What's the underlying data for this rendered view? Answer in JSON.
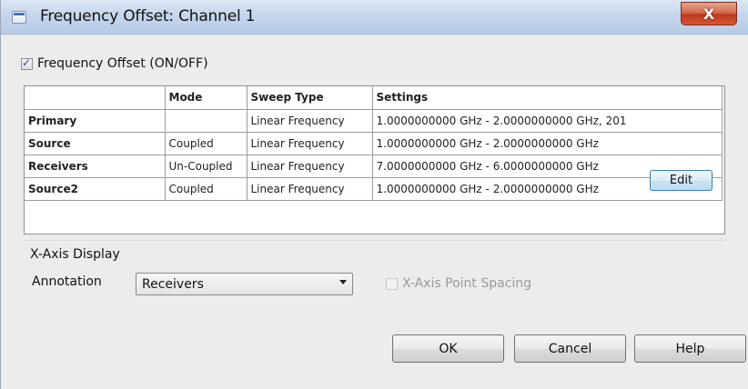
{
  "window": {
    "title": "Frequency Offset: Channel 1",
    "close_label": "X"
  },
  "frequency_offset": {
    "label": "Frequency Offset (ON/OFF)",
    "checked": true
  },
  "table": {
    "headers": [
      "",
      "Mode",
      "Sweep Type",
      "Settings"
    ],
    "rows": [
      {
        "name": "Primary",
        "mode": "",
        "sweep_type": "Linear Frequency",
        "settings": "1.0000000000 GHz - 2.0000000000 GHz, 201"
      },
      {
        "name": "Source",
        "mode": "Coupled",
        "sweep_type": "Linear Frequency",
        "settings": "1.0000000000 GHz - 2.0000000000 GHz"
      },
      {
        "name": "Receivers",
        "mode": "Un-Coupled",
        "sweep_type": "Linear Frequency",
        "settings": "7.0000000000 GHz - 6.0000000000 GHz"
      },
      {
        "name": "Source2",
        "mode": "Coupled",
        "sweep_type": "Linear Frequency",
        "settings": "1.0000000000 GHz - 2.0000000000 GHz"
      }
    ],
    "edit_label": "Edit"
  },
  "x_axis": {
    "group_title": "X-Axis Display",
    "annotation_label": "Annotation",
    "annotation_value": "Receivers",
    "point_spacing_label": "X-Axis Point Spacing",
    "point_spacing_checked": false,
    "point_spacing_enabled": false
  },
  "buttons": {
    "ok": "OK",
    "cancel": "Cancel",
    "help": "Help"
  }
}
